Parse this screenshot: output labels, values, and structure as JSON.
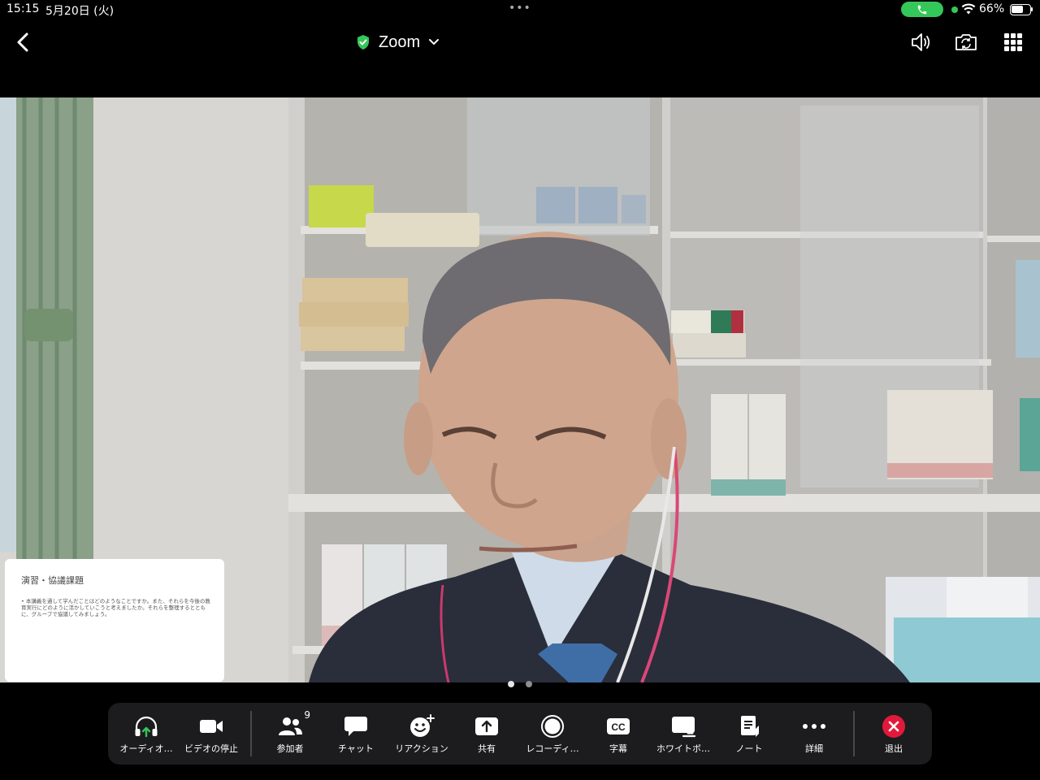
{
  "status_bar": {
    "time": "15:15",
    "date": "5月20日 (火)",
    "multitask_dots": "•••",
    "battery_percent": "66%",
    "battery_level": 0.66,
    "call_active_color": "#34c759"
  },
  "nav": {
    "title": "Zoom",
    "secure_icon_color": "#34c759"
  },
  "shared_content": {
    "slide_title": "演習・協議課題",
    "slide_body": "• 本講義を通して学んだことはどのようなことですか。また、それらを今後の教育実行にどのように活かしていこうと考えましたか。それらを整理するとともに、グループで協議してみましょう。"
  },
  "pager": {
    "pages": 2,
    "active_index": 0
  },
  "toolbar": {
    "audio_label": "オーディオ…",
    "video_label": "ビデオの停止",
    "participants_label": "参加者",
    "participants_count": "9",
    "chat_label": "チャット",
    "reactions_label": "リアクション",
    "share_label": "共有",
    "record_label": "レコーディ…",
    "captions_label": "字幕",
    "whiteboard_label": "ホワイトボ…",
    "notes_label": "ノート",
    "more_label": "詳細",
    "leave_label": "退出",
    "leave_color": "#e3193b",
    "audio_active_color": "#34c759"
  }
}
